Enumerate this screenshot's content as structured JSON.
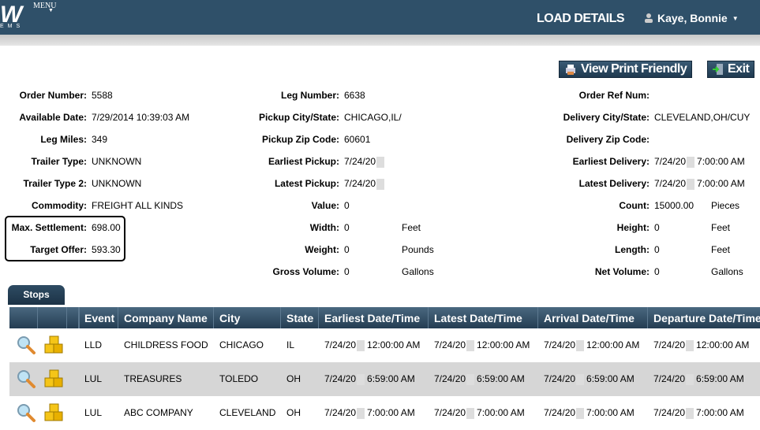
{
  "header": {
    "logo": "W",
    "logo_sub": "EMS",
    "menu": "MENU",
    "title": "LOAD DETAILS",
    "user": "Kaye, Bonnie"
  },
  "toolbar": {
    "print": "View Print Friendly",
    "exit": "Exit"
  },
  "fields": {
    "col1": [
      {
        "label": "Order Number:",
        "value": "5588"
      },
      {
        "label": "Available Date:",
        "value": "7/29/2014 10:39:03 AM"
      },
      {
        "label": "Leg Miles:",
        "value": "349"
      },
      {
        "label": "Trailer Type:",
        "value": "UNKNOWN"
      },
      {
        "label": "Trailer Type 2:",
        "value": "UNKNOWN"
      },
      {
        "label": "Commodity:",
        "value": "FREIGHT ALL KINDS"
      },
      {
        "label": "Max. Settlement:",
        "value": "698.00"
      },
      {
        "label": "Target Offer:",
        "value": "593.30"
      }
    ],
    "col2": [
      {
        "label": "Leg Number:",
        "value": "6638"
      },
      {
        "label": "Pickup City/State:",
        "value": "CHICAGO,IL/"
      },
      {
        "label": "Pickup Zip Code:",
        "value": "60601"
      },
      {
        "label": "Earliest Pickup:",
        "value": "7/24/20"
      },
      {
        "label": "Latest Pickup:",
        "value": "7/24/20"
      },
      {
        "label": "Value:",
        "value": "0"
      },
      {
        "label": "Width:",
        "value": "0",
        "unit": "Feet"
      },
      {
        "label": "Weight:",
        "value": "0",
        "unit": "Pounds"
      },
      {
        "label": "Gross Volume:",
        "value": "0",
        "unit": "Gallons"
      }
    ],
    "col3": [
      {
        "label": "Order Ref Num:",
        "value": ""
      },
      {
        "label": "Delivery City/State:",
        "value": "CLEVELAND,OH/CUY"
      },
      {
        "label": "Delivery Zip Code:",
        "value": ""
      },
      {
        "label": "Earliest Delivery:",
        "value": "7/24/20",
        "time": "7:00:00 AM"
      },
      {
        "label": "Latest Delivery:",
        "value": "7/24/20",
        "time": "7:00:00 AM"
      },
      {
        "label": "Count:",
        "value": "15000.00",
        "unit": "Pieces"
      },
      {
        "label": "Height:",
        "value": "0",
        "unit": "Feet"
      },
      {
        "label": "Length:",
        "value": "0",
        "unit": "Feet"
      },
      {
        "label": "Net Volume:",
        "value": "0",
        "unit": "Gallons"
      }
    ]
  },
  "stops": {
    "tab": "Stops",
    "columns": [
      "Event",
      "Company Name",
      "City",
      "State",
      "Earliest Date/Time",
      "Latest Date/Time",
      "Arrival Date/Time",
      "Departure Date/Time"
    ],
    "rows": [
      {
        "event": "LLD",
        "company": "CHILDRESS FOOD",
        "city": "CHICAGO",
        "state": "IL",
        "date": "7/24/20",
        "times": [
          "12:00:00 AM",
          "12:00:00 AM",
          "12:00:00 AM",
          "12:00:00 AM"
        ]
      },
      {
        "event": "LUL",
        "company": "TREASURES",
        "city": "TOLEDO",
        "state": "OH",
        "date": "7/24/20",
        "times": [
          "6:59:00 AM",
          "6:59:00 AM",
          "6:59:00 AM",
          "6:59:00 AM"
        ]
      },
      {
        "event": "LUL",
        "company": "ABC COMPANY",
        "city": "CLEVELAND",
        "state": "OH",
        "date": "7/24/20",
        "times": [
          "7:00:00 AM",
          "7:00:00 AM",
          "7:00:00 AM",
          "7:00:00 AM"
        ]
      }
    ]
  }
}
